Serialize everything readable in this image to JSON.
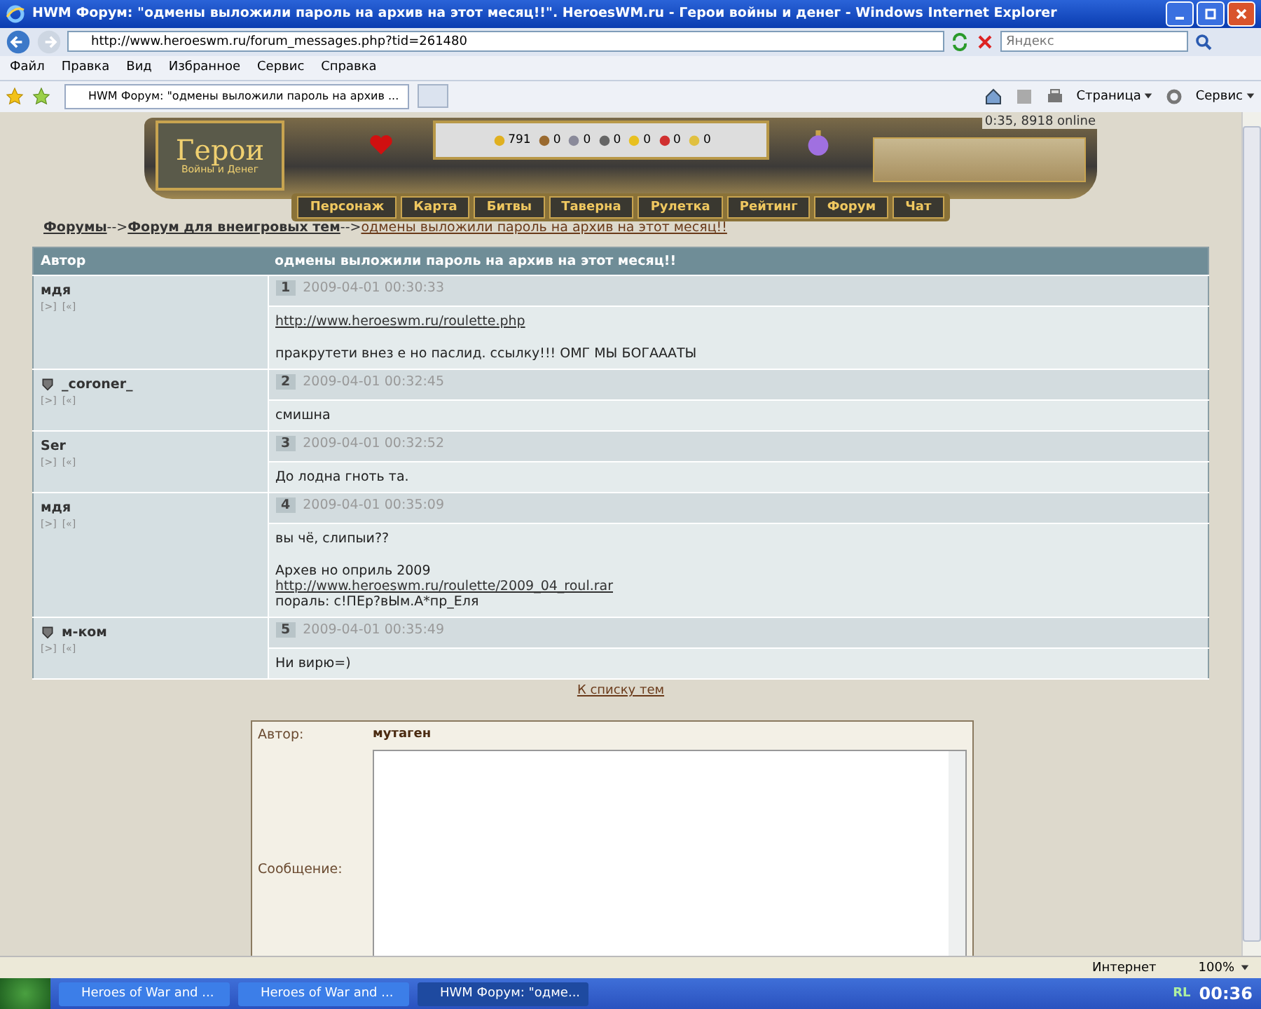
{
  "browser": {
    "title": "HWM Форум: \"одмены выложили пароль на архив на этот месяц!!\". HeroesWM.ru - Герои войны и денег - Windows Internet Explorer",
    "address": "http://www.heroeswm.ru/forum_messages.php?tid=261480",
    "search_placeholder": "Яндекс",
    "menu": [
      "Файл",
      "Правка",
      "Вид",
      "Избранное",
      "Сервис",
      "Справка"
    ],
    "tab_title": "HWM Форум: \"одмены выложили пароль на архив ...",
    "toolbar": [
      "Страница",
      "Сервис"
    ]
  },
  "header": {
    "logo_title": "Герои",
    "logo_subtitle": "Войны и Денег",
    "online": "0:35, 8918 online",
    "resources": [
      "791",
      "0",
      "0",
      "0",
      "0",
      "0",
      "0"
    ],
    "nav": [
      "Персонаж",
      "Карта",
      "Битвы",
      "Таверна",
      "Рулетка",
      "Рейтинг",
      "Форум",
      "Чат"
    ]
  },
  "breadcrumb": [
    {
      "label": "Форумы",
      "kind": "bold"
    },
    {
      "label": "-->",
      "kind": "sep"
    },
    {
      "label": "Форум для внеигровых тем",
      "kind": "bold"
    },
    {
      "label": "-->",
      "kind": "sep"
    },
    {
      "label": "одмены выложили пароль на архив на этот месяц!!",
      "kind": "link"
    }
  ],
  "table": {
    "columns": [
      "Автор",
      "одмены выложили пароль на архив на этот месяц!!"
    ],
    "posts": [
      {
        "author": "мдя",
        "badge": false,
        "links": [
          "[>]",
          "[«]"
        ],
        "number": "1",
        "date": "2009-04-01 00:30:33",
        "paragraphs": [
          [
            {
              "kind": "link",
              "text": "http://www.heroeswm.ru/roulette.php"
            }
          ],
          [
            {
              "kind": "text",
              "text": "пракрутети внез е но паслид. ссылку!!! ОМГ МЫ БОГАААТЫ"
            }
          ]
        ]
      },
      {
        "author": "_coroner_",
        "badge": true,
        "links": [
          "[>]",
          "[«]"
        ],
        "number": "2",
        "date": "2009-04-01 00:32:45",
        "paragraphs": [
          [
            {
              "kind": "text",
              "text": "смишна"
            }
          ]
        ]
      },
      {
        "author": "Ser",
        "badge": false,
        "links": [
          "[>]",
          "[«]"
        ],
        "number": "3",
        "date": "2009-04-01 00:32:52",
        "paragraphs": [
          [
            {
              "kind": "text",
              "text": "До лодна гноть та."
            }
          ]
        ]
      },
      {
        "author": "мдя",
        "badge": false,
        "links": [
          "[>]",
          "[«]"
        ],
        "number": "4",
        "date": "2009-04-01 00:35:09",
        "paragraphs": [
          [
            {
              "kind": "text",
              "text": "вы чё, слипыи??"
            }
          ],
          [
            {
              "kind": "text",
              "text": "Архев но оприль 2009"
            },
            {
              "kind": "link",
              "text": "http://www.heroeswm.ru/roulette/2009_04_roul.rar"
            },
            {
              "kind": "text",
              "text": "пораль: с!ПЕр?вЫм.А*пр_Еля"
            }
          ]
        ]
      },
      {
        "author": "м-ком",
        "badge": true,
        "links": [
          "[>]",
          "[«]"
        ],
        "number": "5",
        "date": "2009-04-01 00:35:49",
        "paragraphs": [
          [
            {
              "kind": "text",
              "text": "Ни вирю=)"
            }
          ]
        ]
      }
    ]
  },
  "back_link": "К списку тем",
  "form": {
    "author_label": "Автор:",
    "author": "мутаген",
    "message_label": "Сообщение:"
  },
  "status": {
    "zone": "Интернет",
    "zoom": "100%"
  },
  "taskbar": {
    "tasks": [
      {
        "label": "Heroes of War and ...",
        "selected": false
      },
      {
        "label": "Heroes of War and ...",
        "selected": false
      },
      {
        "label": "HWM Форум: \"одме...",
        "selected": true
      }
    ],
    "tray": "RL",
    "clock": "00:36"
  }
}
